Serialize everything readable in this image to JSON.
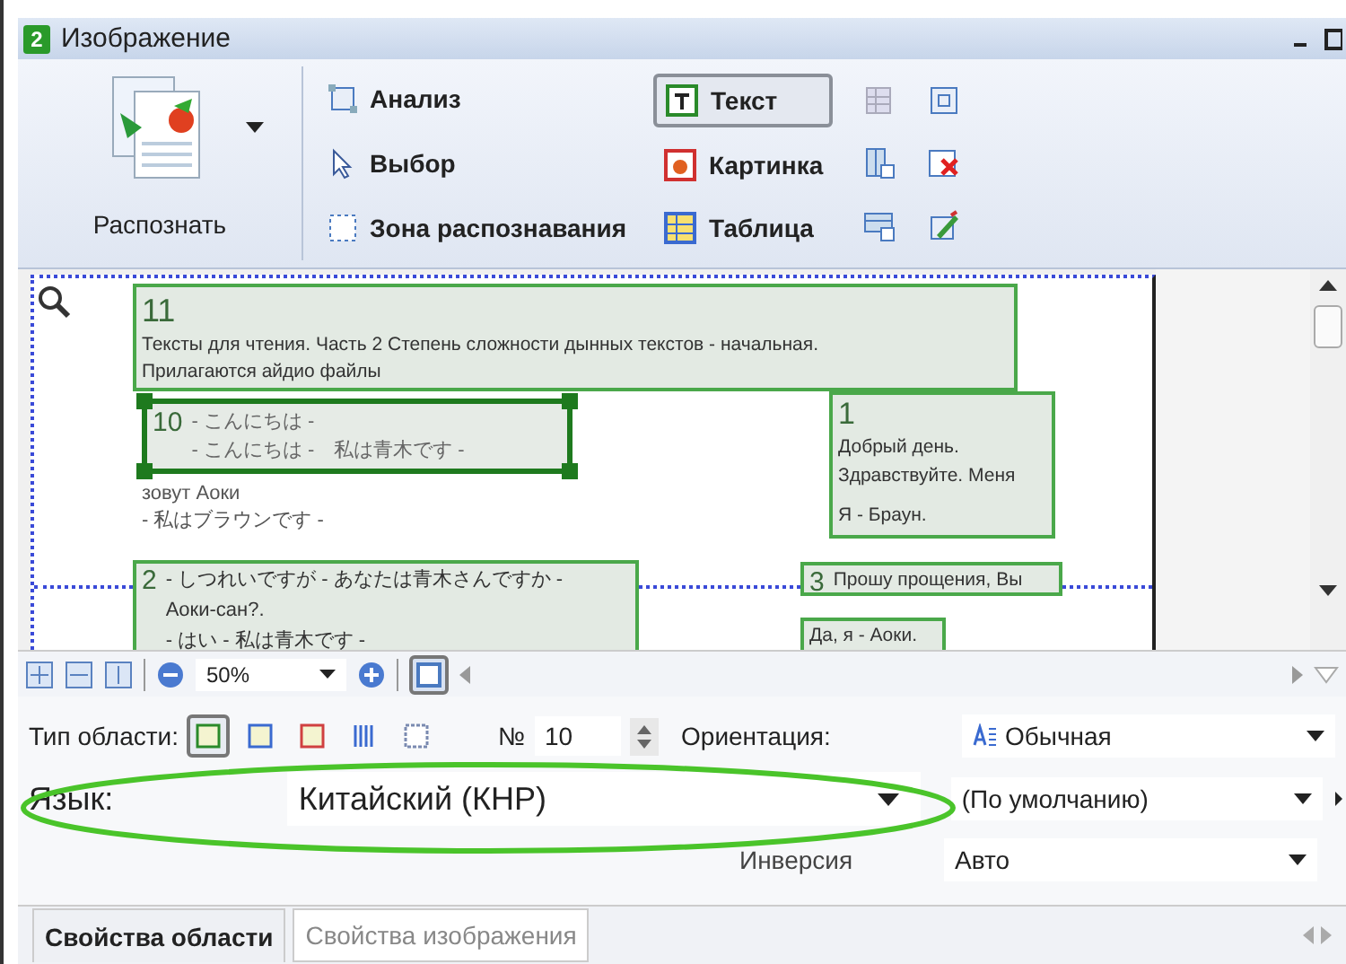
{
  "window": {
    "badge": "2",
    "title": "Изображение"
  },
  "toolbar": {
    "recognize": {
      "label": "Распознать"
    },
    "tools": [
      {
        "label": "Анализ",
        "kind": "analysis"
      },
      {
        "label": "Выбор",
        "kind": "select"
      },
      {
        "label": "Зона распознавания",
        "kind": "zone"
      }
    ],
    "area_types": [
      {
        "label": "Текст",
        "kind": "text",
        "selected": true
      },
      {
        "label": "Картинка",
        "kind": "picture",
        "selected": false
      },
      {
        "label": "Таблица",
        "kind": "table",
        "selected": false
      }
    ]
  },
  "document": {
    "loose_lines": [
      "зовут Аоки",
      "- 私はブラウンです -"
    ],
    "regions": [
      {
        "number": "11",
        "lines": [
          "Тексты для чтения. Часть 2 Степень сложности дынных текстов - начальная.",
          "Прилагаются айдио файлы"
        ],
        "selected": false
      },
      {
        "number": "10",
        "lines": [
          "- こんにちは -",
          "- こんにちは -　私は青木です -"
        ],
        "selected": true
      },
      {
        "number": "1",
        "lines": [
          "Добрый день.",
          "Здравствуйте. Меня",
          "Я - Браун."
        ],
        "selected": false
      },
      {
        "number": "2",
        "lines": [
          "- しつれいですが - あなたは青木さんですか -",
          "Аоки-сан?.",
          "- はい - 私は青木です -"
        ],
        "selected": false
      },
      {
        "number": "3",
        "lines": [
          "Прошу прощения, Вы"
        ],
        "selected": false
      },
      {
        "lines": [
          "Да, я - Аоки."
        ],
        "selected": false
      }
    ]
  },
  "zoom": {
    "value": "50%",
    "fit_page": true
  },
  "properties": {
    "area_type_label": "Тип области:",
    "area_type_buttons": [
      {
        "kind": "text",
        "selected": true
      },
      {
        "kind": "picture",
        "selected": false
      },
      {
        "kind": "image",
        "selected": false
      },
      {
        "kind": "table",
        "selected": false
      },
      {
        "kind": "background",
        "selected": false
      }
    ],
    "number_label": "№",
    "number": "10",
    "orientation_label": "Ориентация:",
    "orientation": "Обычная",
    "language_label": "Язык:",
    "language": "Китайский (КНР)",
    "print_type": "(По умолчанию)",
    "inversion_label": "Инверсия",
    "inversion": "Авто"
  },
  "tabs": [
    {
      "label": "Свойства области",
      "selected": true
    },
    {
      "label": "Свойства изображения",
      "selected": false
    }
  ]
}
